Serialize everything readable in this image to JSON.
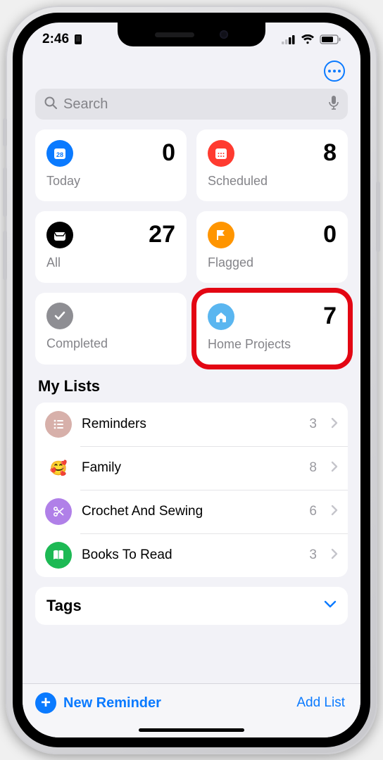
{
  "status": {
    "time": "2:46"
  },
  "search": {
    "placeholder": "Search"
  },
  "cards": {
    "today": {
      "label": "Today",
      "count": "0"
    },
    "scheduled": {
      "label": "Scheduled",
      "count": "8"
    },
    "all": {
      "label": "All",
      "count": "27"
    },
    "flagged": {
      "label": "Flagged",
      "count": "0"
    },
    "completed": {
      "label": "Completed",
      "count": ""
    },
    "home": {
      "label": "Home Projects",
      "count": "7"
    }
  },
  "sections": {
    "mylists": "My Lists",
    "tags": "Tags"
  },
  "lists": [
    {
      "label": "Reminders",
      "count": "3",
      "color": "#d7b0aa",
      "emoji": ""
    },
    {
      "label": "Family",
      "count": "8",
      "color": "",
      "emoji": "🥰"
    },
    {
      "label": "Crochet And Sewing",
      "count": "6",
      "color": "#b080e8",
      "emoji": ""
    },
    {
      "label": "Books To Read",
      "count": "3",
      "color": "#1db954",
      "emoji": ""
    }
  ],
  "toolbar": {
    "new_reminder": "New Reminder",
    "add_list": "Add List"
  }
}
